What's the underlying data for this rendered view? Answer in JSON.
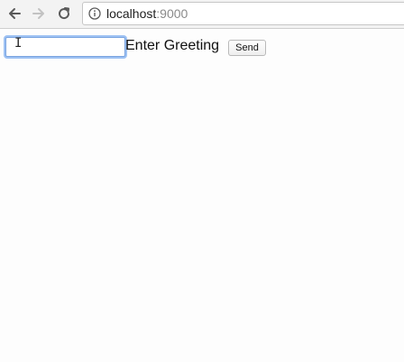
{
  "browser": {
    "url_host": "localhost",
    "url_port": ":9000",
    "icons": {
      "back": "back-arrow-icon",
      "forward": "forward-arrow-icon",
      "reload": "reload-icon",
      "info": "info-icon"
    }
  },
  "form": {
    "input_value": "",
    "label": "Enter Greeting",
    "send_label": "Send"
  },
  "colors": {
    "focus_ring": "#9ec2f3",
    "toolbar_bg": "#f3f3f3",
    "page_bg": "#fdfdfd"
  }
}
